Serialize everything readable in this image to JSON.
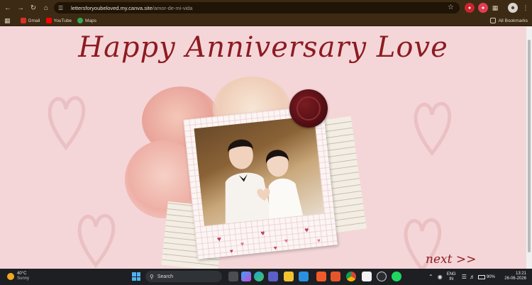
{
  "browser": {
    "url_host": "lettersforyoubeloved.my.canva.site",
    "url_path": "/amor-de-mi-vida"
  },
  "bookmarks": [
    {
      "label": "Gmail",
      "color": "#d93025"
    },
    {
      "label": "YouTube",
      "color": "#ff0000"
    },
    {
      "label": "Maps",
      "color": "#34a853"
    }
  ],
  "all_bookmarks": "All Bookmarks",
  "page": {
    "title": "Happy Anniversary Love",
    "next_label": "next >>",
    "accent_color": "#8e1b22",
    "background_color": "#f4d6d8"
  },
  "taskbar": {
    "temperature": "40°C",
    "condition": "Sunny",
    "search_label": "Search",
    "language_top": "ENG",
    "language_bottom": "IN",
    "battery": "90%",
    "time": "13:21",
    "date": "26-06-2026"
  }
}
